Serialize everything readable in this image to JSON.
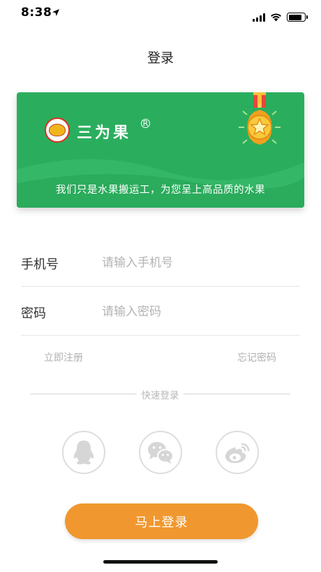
{
  "status_bar": {
    "time": "8:38",
    "icons": [
      "location-arrow-icon",
      "cellular-signal-icon",
      "wifi-icon",
      "battery-icon"
    ],
    "battery_level": 0.85
  },
  "nav": {
    "title": "登录"
  },
  "banner": {
    "brand_name": "三为果",
    "registered_mark": "R",
    "slogan": "我们只是水果搬运工，为您呈上高品质的水果",
    "background_color": "#2aae5d",
    "icons": [
      "brand-logo-icon",
      "medal-icon"
    ]
  },
  "form": {
    "phone": {
      "label": "手机号",
      "value": "",
      "placeholder": "请输入手机号"
    },
    "password": {
      "label": "密码",
      "value": "",
      "placeholder": "请输入密码"
    }
  },
  "links": {
    "register": "立即注册",
    "forgot": "忘记密码"
  },
  "quick_login": {
    "label": "快速登录",
    "providers": [
      {
        "name": "qq",
        "icon": "qq-icon"
      },
      {
        "name": "wechat",
        "icon": "wechat-icon"
      },
      {
        "name": "weibo",
        "icon": "weibo-icon"
      }
    ]
  },
  "login_button": {
    "label": "马上登录",
    "color": "#f0982f"
  }
}
